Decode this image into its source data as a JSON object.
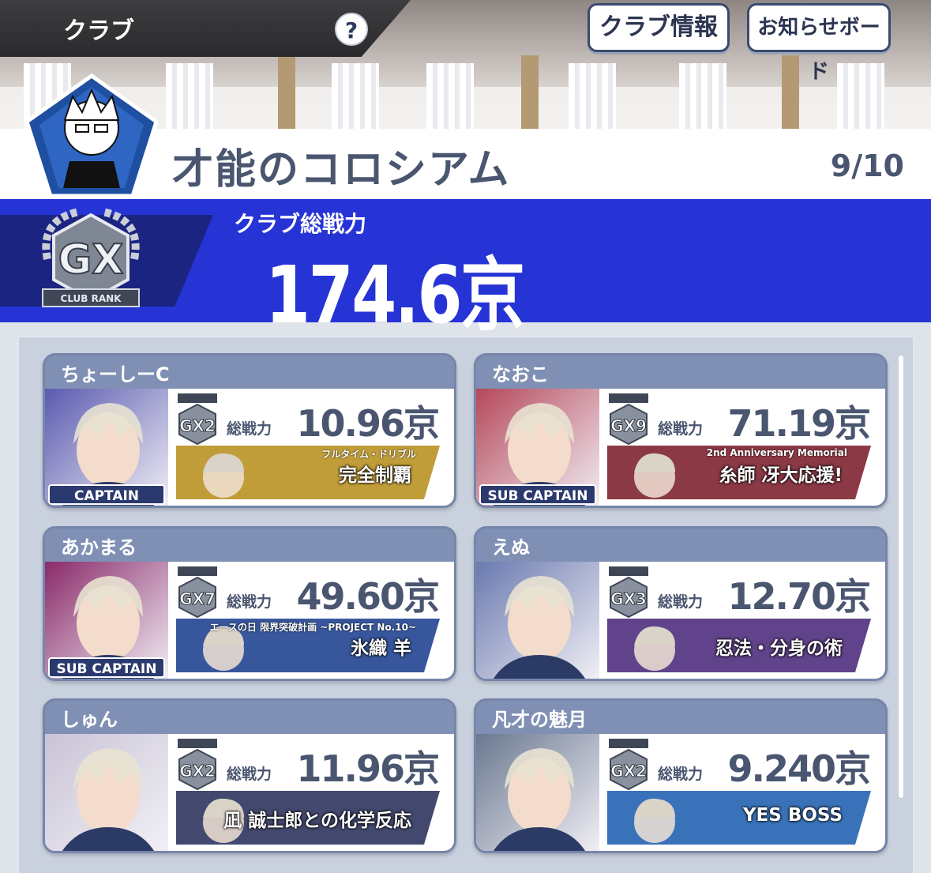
{
  "header": {
    "title": "クラブ",
    "help_icon": "?",
    "club_info_button": "クラブ情報",
    "notice_board_button": "お知らせボード"
  },
  "club": {
    "name": "才能のコロシアム",
    "member_count": "9/10",
    "power_label": "クラブ総戦力",
    "power_value": "174.6京",
    "rank_badge": "GX",
    "rank_caption": "CLUB RANK"
  },
  "members": [
    {
      "name": "ちょーしーC",
      "role": "CAPTAIN",
      "team_rank": "GX2",
      "power_caption": "総戦力",
      "power": "10.96京",
      "title_text": "完全制覇",
      "title_sub": "フルタイム・ドリブル",
      "plate_color": "#b8901e",
      "portrait_color": "#5a5ab0"
    },
    {
      "name": "なおこ",
      "role": "SUB CAPTAIN",
      "team_rank": "GX9",
      "power_caption": "総戦力",
      "power": "71.19京",
      "title_text": "糸師 冴大応援!",
      "title_sub": "2nd Anniversary Memorial",
      "plate_color": "#7a1e2c",
      "portrait_color": "#b5485a"
    },
    {
      "name": "あかまる",
      "role": "SUB CAPTAIN",
      "team_rank": "GX7",
      "power_caption": "総戦力",
      "power": "49.60京",
      "title_text": "氷織 羊",
      "title_sub": "エースの日 限界突破計画 ~PROJECT No.10~",
      "plate_color": "#1d3f8f",
      "portrait_color": "#8a2a6a"
    },
    {
      "name": "えぬ",
      "role": "",
      "team_rank": "GX3",
      "power_caption": "総戦力",
      "power": "12.70京",
      "title_text": "忍法・分身の術",
      "title_sub": "",
      "plate_color": "#4a2a7a",
      "portrait_color": "#6a7ab0"
    },
    {
      "name": "しゅん",
      "role": "",
      "team_rank": "GX2",
      "power_caption": "総戦力",
      "power": "11.96京",
      "title_text": "凪 誠士郎との化学反応",
      "title_sub": "",
      "plate_color": "#2a2f5a",
      "portrait_color": "#c9c4d6"
    },
    {
      "name": "凡才の魅月",
      "role": "",
      "team_rank": "GX2",
      "power_caption": "総戦力",
      "power": "9.240京",
      "title_text": "YES BOSS",
      "title_sub": "",
      "plate_color": "#1e5fb0",
      "portrait_color": "#6a7890"
    }
  ]
}
